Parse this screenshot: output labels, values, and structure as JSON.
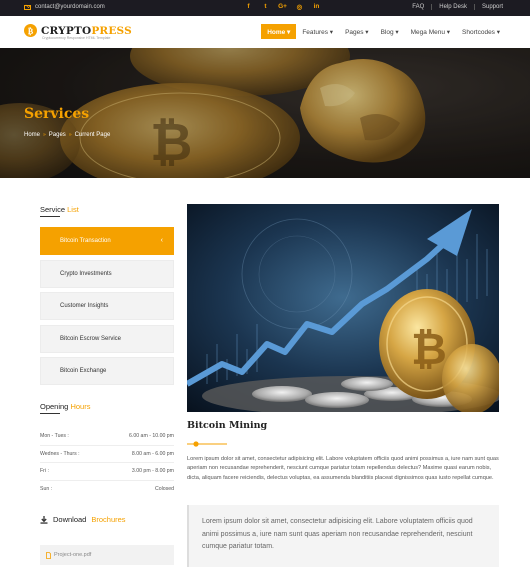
{
  "topbar": {
    "email": "contact@yourdomain.com",
    "social": [
      "f",
      "t",
      "G+",
      "◎",
      "in"
    ],
    "links": [
      "FAQ",
      "Help Desk",
      "Support"
    ]
  },
  "header": {
    "logo_text_a": "CRYPTO",
    "logo_text_b": "PRESS",
    "logo_tagline": "Cryptocurrency Responsive HTML Template",
    "nav": [
      {
        "label": "Home ▾",
        "active": true
      },
      {
        "label": "Features ▾",
        "active": false
      },
      {
        "label": "Pages ▾",
        "active": false
      },
      {
        "label": "Blog ▾",
        "active": false
      },
      {
        "label": "Mega Menu ▾",
        "active": false
      },
      {
        "label": "Shortcodes ▾",
        "active": false
      }
    ]
  },
  "hero": {
    "title": "Services",
    "breadcrumb": [
      "Home",
      "»",
      "Pages",
      "»",
      "Current Page"
    ]
  },
  "sidebar": {
    "services_title_a": "Service",
    "services_title_b": "List",
    "services": [
      {
        "label": "Bitcoin Transaction",
        "active": true
      },
      {
        "label": "Crypto Investments",
        "active": false
      },
      {
        "label": "Customer Insights",
        "active": false
      },
      {
        "label": "Bitcoin Escrow Service",
        "active": false
      },
      {
        "label": "Bitcoin Exchange",
        "active": false
      }
    ],
    "hours_title_a": "Opening",
    "hours_title_b": "Hours",
    "hours": [
      {
        "day": "Mon - Tues :",
        "time": "6.00 am - 10.00 pm"
      },
      {
        "day": "Wednes - Thurs :",
        "time": "8.00 am - 6.00 pm"
      },
      {
        "day": "Fri :",
        "time": "3.00 pm - 8.00 pm"
      },
      {
        "day": "Sun :",
        "time": "Colosed"
      }
    ],
    "download_title_a": "Download",
    "download_title_b": "Brochures",
    "file": "Project-one.pdf"
  },
  "main": {
    "title": "Bitcoin Mining",
    "paragraph": "Lorem ipsum dolor sit amet, consectetur adipisicing elit. Labore voluptatem officiis quod animi possimus a, iure nam sunt quas aperiam non recusandae reprehenderit, nesciunt cumque pariatur totam repellendus delectus? Maxime quasi earum nobis, dicta, aliquam facere reiciendis, delectus voluptas, ea assumenda blanditiis placeat dignissimos quas iusto repellat cumque.",
    "quote": "Lorem ipsum dolor sit amet, consectetur adipisicing elit. Labore voluptatem officiis quod animi possimus a, iure nam sunt quas aperiam non recusandae reprehenderit, nesciunt cumque pariatur totam."
  },
  "colors": {
    "accent": "#f5a100",
    "dark": "#1c1b22"
  }
}
